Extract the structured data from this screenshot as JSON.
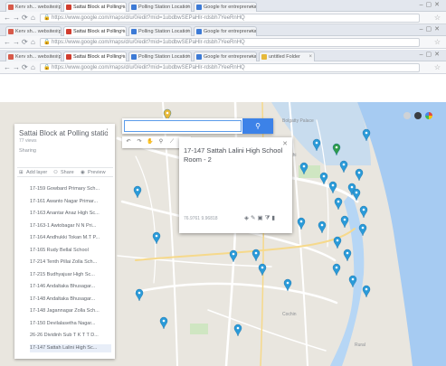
{
  "browser": {
    "windows": [
      {
        "tabs": [
          {
            "label": "Kerv sh... websites.pdf",
            "active": false,
            "favicon": "#d75a4a"
          },
          {
            "label": "Sattai Block at Polling s...",
            "active": true,
            "favicon": "#d13d2f"
          },
          {
            "label": "Polling Station Location ...",
            "active": false,
            "favicon": "#3c7ad6"
          },
          {
            "label": "Google for entrepreneurs ...",
            "active": false,
            "favicon": "#3c7ad6"
          }
        ],
        "url": "https://www.google.com/maps/d/u/0/edit?mid=1ubdbwSEPaHlr-rdsbh7YeeRnHQ"
      },
      {
        "tabs": [
          {
            "label": "Kerv sh... websites.pdf",
            "active": false,
            "favicon": "#d75a4a"
          },
          {
            "label": "Sattai Block at Polling s...",
            "active": true,
            "favicon": "#d13d2f"
          },
          {
            "label": "Polling Station Location ...",
            "active": false,
            "favicon": "#3c7ad6"
          },
          {
            "label": "Google for entrepreneurs ...",
            "active": false,
            "favicon": "#3c7ad6"
          }
        ],
        "url": "https://www.google.com/maps/d/u/0/edit?mid=1ubdbwSEPaHlr-rdsbh7YeeRnHQ"
      },
      {
        "tabs": [
          {
            "label": "Kerv sh... websites.pdf",
            "active": false,
            "favicon": "#d75a4a"
          },
          {
            "label": "Sattai Block at Polling s...",
            "active": true,
            "favicon": "#d13d2f"
          },
          {
            "label": "Polling Station Location ...",
            "active": false,
            "favicon": "#3c7ad6"
          },
          {
            "label": "Google for entrepreneurs ...",
            "active": false,
            "favicon": "#3c7ad6"
          },
          {
            "label": "untitled Folder",
            "active": false,
            "favicon": "#e6b93a"
          }
        ],
        "url": "https://www.google.com/maps/d/u/0/edit?mid=1ubdbwSEPaHlr-rdsbh7YeeRnHQ"
      }
    ]
  },
  "panel": {
    "title": "Sattai Block at Polling station map",
    "more_icon": "more-vert-icon",
    "subtitle": "77 views",
    "share_text": "Sharing",
    "actions": {
      "add_layer": "Add layer",
      "share": "Share",
      "preview": "Preview"
    },
    "items": [
      {
        "label": "17-159 Gowbard Primary Sch...",
        "dot": "#2a9ad8",
        "selected": false
      },
      {
        "label": "17-161 Awanto Nagar Primar...",
        "dot": "#2a9ad8",
        "selected": false
      },
      {
        "label": "17-163 Anantar Anaz High Sc...",
        "dot": "#2a9ad8",
        "selected": false
      },
      {
        "label": "17-163-1 Awtobagar N N Pri...",
        "dot": "#2a9ad8",
        "selected": false
      },
      {
        "label": "17-164 Andhukki Tokan M.T P...",
        "dot": "#8b3c8f",
        "selected": false
      },
      {
        "label": "17-165 Rudy Bellal School",
        "dot": "#2a9ad8",
        "selected": false
      },
      {
        "label": "17-214 Tenth Pillai Zolla Sch...",
        "dot": "#2a9ad8",
        "selected": false
      },
      {
        "label": "17-215 Budhyajuar High Sc...",
        "dot": "#2a9ad8",
        "selected": false
      },
      {
        "label": "17-146 Andaltaka Bhusagar...",
        "dot": "#2a9ad8",
        "selected": false
      },
      {
        "label": "17-148 Andaltaka Bhusagar...",
        "dot": "#2a9ad8",
        "selected": false
      },
      {
        "label": "17-148 Jagannagar Zolla Sch...",
        "dot": "#2a9ad8",
        "selected": false
      },
      {
        "label": "17-150 Devilalasetha Nagar...",
        "dot": "#2a9ad8",
        "selected": false
      },
      {
        "label": "26-26 Dividinh Sub T K T T D...",
        "dot": "#2a9ad8",
        "selected": false
      },
      {
        "label": "17-147 Sattah Lalini High Sc...",
        "dot": "#2a9ad8",
        "selected": true
      }
    ]
  },
  "search": {
    "placeholder": "",
    "value": "",
    "button_icon": "search-icon"
  },
  "tools": [
    "undo-icon",
    "redo-icon",
    "hand-icon",
    "marker-icon",
    "line-icon",
    "measure-icon"
  ],
  "card": {
    "title": "17-147 Sattah Lalini High School Room - 2",
    "close_icon": "close-icon",
    "coords": "76.9761 9.96818",
    "icons": [
      "paint-icon",
      "edit-icon",
      "photo-icon",
      "filter-icon",
      "delete-icon"
    ]
  },
  "map": {
    "water_color": "#a6cbf2",
    "land_color": "#e9e6df",
    "pin_color": "#2a9ad8",
    "pin_green": "#2e9b4a",
    "pin_yellow": "#e6b93a",
    "labels": [
      "Bolgatty Palace",
      "Kochi",
      "Cochin",
      "Rural"
    ]
  }
}
